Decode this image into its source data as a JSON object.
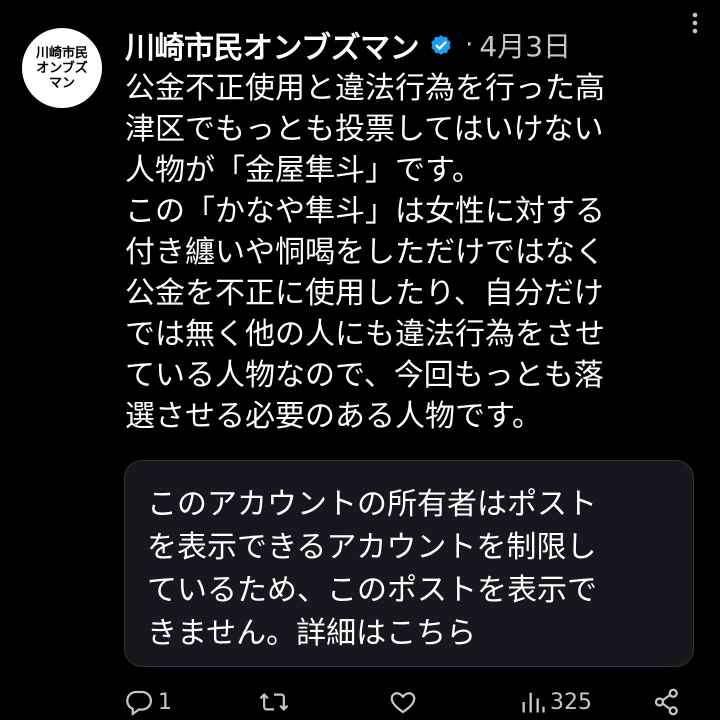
{
  "tweet": {
    "avatar_lines": [
      "川崎市民",
      "オンブズ",
      "マン"
    ],
    "author_name": "川崎市民オンブズマン",
    "separator": "·",
    "date": "4月3日",
    "body_lines": [
      "公金不正使用と違法行為を行った高",
      "津区でもっとも投票してはいけない",
      "人物が「金屋隼斗」です。",
      "この「かなや隼斗」は女性に対する",
      "付き纏いや恫喝をしただけではなく",
      "公金を不正に使用したり、自分だけ",
      "では無く他の人にも違法行為をさせ",
      "ている人物なので、今回もっとも落",
      "選させる必要のある人物です。"
    ],
    "quoted_notice_lines": [
      "このアカウントの所有者はポスト",
      "を表示できるアカウントを制限し",
      "ているため、このポストを表示で",
      "きません。詳細はこちら"
    ],
    "actions": {
      "reply_count": "1",
      "retweet_count": "",
      "like_count": "",
      "views_count": "325"
    }
  },
  "colors": {
    "background": "#000000",
    "text": "#e7e9ea",
    "secondary_text": "#c4c7ca",
    "verified_badge": "#1d9bf0",
    "card_border": "#2f3336"
  },
  "icons": {
    "verified": "verified-badge-icon",
    "more": "more-vertical-icon",
    "reply": "reply-icon",
    "retweet": "retweet-icon",
    "like": "heart-icon",
    "views": "views-chart-icon",
    "share": "share-icon"
  }
}
